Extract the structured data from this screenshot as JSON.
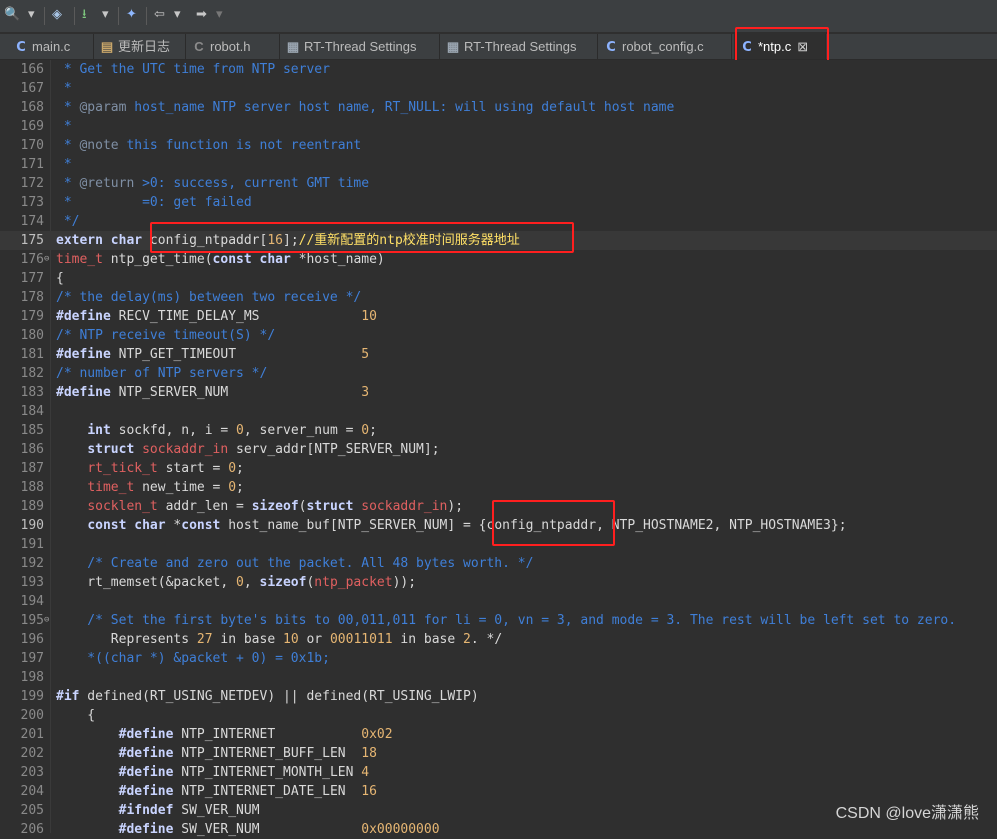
{
  "toolbar": {
    "icons": [
      "search-icon",
      "dropdown-arrow",
      "build-icon",
      "download-icon",
      "debug-icon",
      "back-arrow-icon",
      "forward-arrow-icon"
    ],
    "search_glyph": "🔍",
    "arrow_glyph": "▾",
    "build_glyph": "◈",
    "download_glyph": "⭳",
    "debug_glyph": "✦",
    "back_glyph": "⇦",
    "forward_glyph": "➡"
  },
  "tabs": [
    {
      "label": "main.c",
      "icon": "c-file-icon",
      "icon_char": "C",
      "active": false
    },
    {
      "label": "更新日志",
      "icon": "document-icon",
      "icon_char": "▤",
      "active": false
    },
    {
      "label": "robot.h",
      "icon": "header-file-icon",
      "icon_char": "C",
      "active": false
    },
    {
      "label": "RT-Thread Settings",
      "icon": "settings-icon",
      "icon_char": "▦",
      "active": false
    },
    {
      "label": "RT-Thread Settings",
      "icon": "settings-icon",
      "icon_char": "▦",
      "active": false
    },
    {
      "label": "robot_config.c",
      "icon": "c-file-icon",
      "icon_char": "C",
      "active": false
    },
    {
      "label": "*ntp.c",
      "icon": "c-file-icon",
      "icon_char": "C",
      "active": true,
      "close": "⊠"
    }
  ],
  "editor": {
    "current_line": 175,
    "lines": [
      {
        "n": 166,
        "text": " * Get the UTC time from NTP server"
      },
      {
        "n": 167,
        "text": " *"
      },
      {
        "n": 168,
        "text": " * @param host_name NTP server host name, RT_NULL: will using default host name"
      },
      {
        "n": 169,
        "text": " *"
      },
      {
        "n": 170,
        "text": " * @note this function is not reentrant"
      },
      {
        "n": 171,
        "text": " *"
      },
      {
        "n": 172,
        "text": " * @return >0: success, current GMT time"
      },
      {
        "n": 173,
        "text": " *         =0: get failed"
      },
      {
        "n": 174,
        "text": " */"
      },
      {
        "n": 175,
        "text": "extern char config_ntpaddr[16];//重新配置的ntp校准时间服务器地址"
      },
      {
        "n": 176,
        "text": "time_t ntp_get_time(const char *host_name)",
        "fold": true
      },
      {
        "n": 177,
        "text": "{"
      },
      {
        "n": 178,
        "text": "/* the delay(ms) between two receive */"
      },
      {
        "n": 179,
        "text": "#define RECV_TIME_DELAY_MS             10"
      },
      {
        "n": 180,
        "text": "/* NTP receive timeout(S) */"
      },
      {
        "n": 181,
        "text": "#define NTP_GET_TIMEOUT                5"
      },
      {
        "n": 182,
        "text": "/* number of NTP servers */"
      },
      {
        "n": 183,
        "text": "#define NTP_SERVER_NUM                 3"
      },
      {
        "n": 184,
        "text": ""
      },
      {
        "n": 185,
        "text": "    int sockfd, n, i = 0, server_num = 0;"
      },
      {
        "n": 186,
        "text": "    struct sockaddr_in serv_addr[NTP_SERVER_NUM];"
      },
      {
        "n": 187,
        "text": "    rt_tick_t start = 0;"
      },
      {
        "n": 188,
        "text": "    time_t new_time = 0;"
      },
      {
        "n": 189,
        "text": "    socklen_t addr_len = sizeof(struct sockaddr_in);"
      },
      {
        "n": 190,
        "text": "    const char *const host_name_buf[NTP_SERVER_NUM] = {config_ntpaddr, NTP_HOSTNAME2, NTP_HOSTNAME3};"
      },
      {
        "n": 191,
        "text": ""
      },
      {
        "n": 192,
        "text": "    /* Create and zero out the packet. All 48 bytes worth. */"
      },
      {
        "n": 193,
        "text": "    rt_memset(&packet, 0, sizeof(ntp_packet));"
      },
      {
        "n": 194,
        "text": ""
      },
      {
        "n": 195,
        "text": "    /* Set the first byte's bits to 00,011,011 for li = 0, vn = 3, and mode = 3. The rest will be left set to zero.",
        "fold": true
      },
      {
        "n": 196,
        "text": "       Represents 27 in base 10 or 00011011 in base 2. */"
      },
      {
        "n": 197,
        "text": "    *((char *) &packet + 0) = 0x1b;"
      },
      {
        "n": 198,
        "text": ""
      },
      {
        "n": 199,
        "text": "#if defined(RT_USING_NETDEV) || defined(RT_USING_LWIP)"
      },
      {
        "n": 200,
        "text": "    {"
      },
      {
        "n": 201,
        "text": "        #define NTP_INTERNET           0x02"
      },
      {
        "n": 202,
        "text": "        #define NTP_INTERNET_BUFF_LEN  18"
      },
      {
        "n": 203,
        "text": "        #define NTP_INTERNET_MONTH_LEN 4"
      },
      {
        "n": 204,
        "text": "        #define NTP_INTERNET_DATE_LEN  16"
      },
      {
        "n": 205,
        "text": "        #ifndef SW_VER_NUM"
      },
      {
        "n": 206,
        "text": "        #define SW_VER_NUM             0x00000000"
      }
    ]
  },
  "colors": {
    "comment": "#3f7fd8",
    "doctag": "#7f8fa4",
    "keyword": "#c9d4ff",
    "type": "#e06060",
    "number": "#e6b673",
    "plain": "#d9d9d9",
    "highlight_box": "#ff1f1f"
  },
  "watermark": "CSDN @love潇潇熊"
}
